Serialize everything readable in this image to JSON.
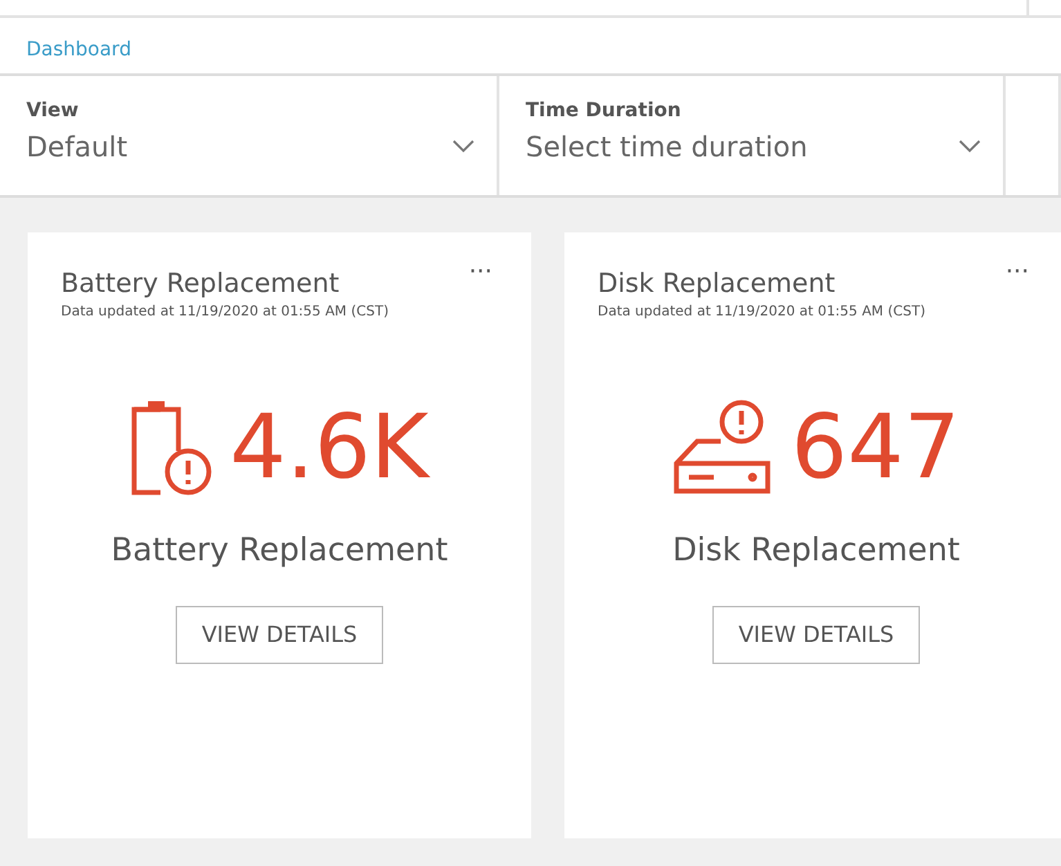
{
  "breadcrumb": {
    "label": "Dashboard"
  },
  "filters": [
    {
      "label": "View",
      "value": "Default"
    },
    {
      "label": "Time Duration",
      "placeholder": "Select time duration"
    }
  ],
  "cards": [
    {
      "kind": "battery",
      "title": "Battery Replacement",
      "updated": "Data updated at 11/19/2020 at 01:55 AM (CST)",
      "menu": "···",
      "value": "4.6K",
      "caption": "Battery Replacement",
      "button": "VIEW DETAILS"
    },
    {
      "kind": "disk",
      "title": "Disk Replacement",
      "updated": "Data updated at 11/19/2020 at 01:55 AM (CST)",
      "menu": "···",
      "value": "647",
      "caption": "Disk Replacement",
      "button": "VIEW DETAILS"
    }
  ]
}
